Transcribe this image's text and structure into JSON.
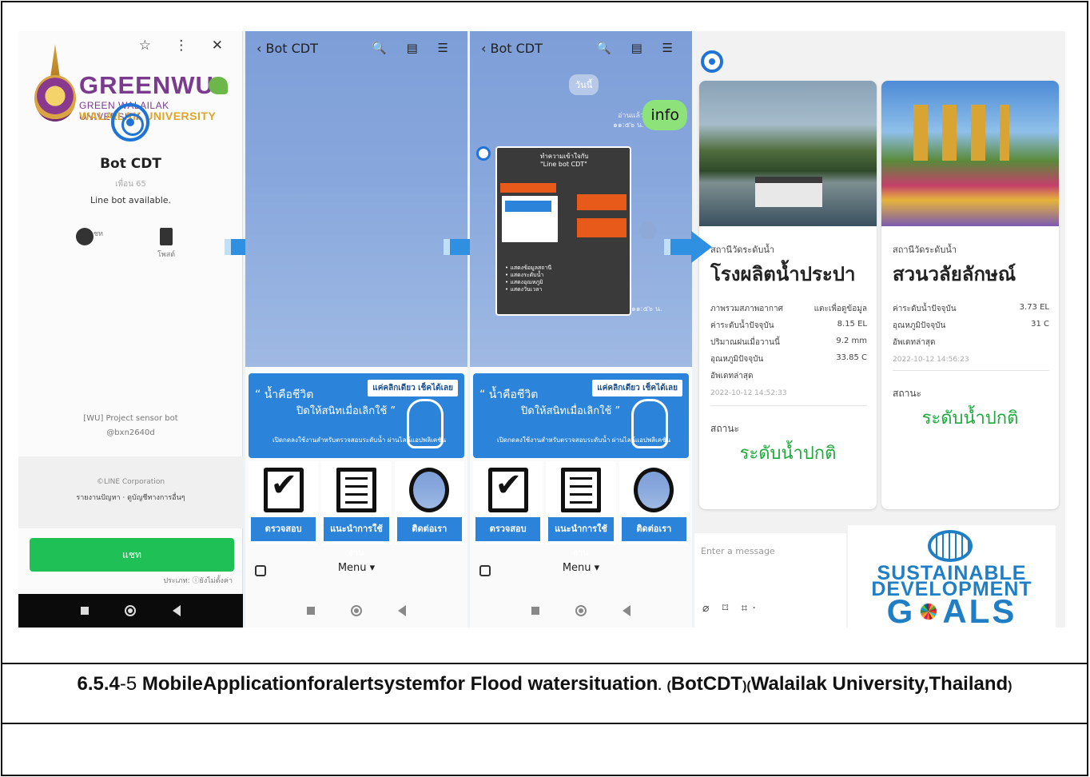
{
  "panel1": {
    "top_icons": "☆ ⋮ ✕",
    "logo_title": "GREENWU",
    "logo_sub1": "GREEN WALAILAK UNIVERSITY",
    "logo_sub2": "WALAILAK UNIVERSITY",
    "bot_name": "Bot CDT",
    "friends": "เพื่อน 65",
    "status": "Line bot available.",
    "actions": [
      {
        "label": "แชท"
      },
      {
        "label": "โพสต์"
      }
    ],
    "project": "[WU] Project sensor bot",
    "line_id": "@bxn2640d",
    "corp": "©LINE Corporation",
    "report": "รายงานปัญหา · ดูบัญชีทางการอื่นๆ",
    "chat_button": "แชท",
    "note": "ประเภท: ⓘยังไม่ตั้งค่า"
  },
  "chat": {
    "title": "Bot CDT",
    "header_icons": "🔍 ▤ ☰",
    "banner_quote1": "“ น้ำคือชีวิต",
    "banner_quote2": "ปิดให้สนิทเมื่อเลิกใช้ ”",
    "banner_tag": "แค่คลิกเดียว เช็คได้เลย",
    "banner_small": "เปิดกดลงใช้งานสำหรับตรวจสอบระดับน้ำ ผ่านไลน์แอปพลิเคชัน",
    "tiles": [
      {
        "label": "ตรวจสอบ"
      },
      {
        "label": "แนะนำการใช้งาน"
      },
      {
        "label": "ติดต่อเรา"
      }
    ],
    "menu": "Menu ▾",
    "day": "วันนี้",
    "info_msg": "info",
    "read_mark": "อ่านแล้ว\n๑๑:๕๖ น.",
    "poster_title": "ทำความเข้าใจกับ\n\"Line bot CDT\"",
    "poster_list": "• แสดงข้อมูลสถานี\n• แสดงระดับน้ำ\n• แสดงอุณหภูมิ\n• แสดงวันเวลา",
    "timestamp": "๑๑:๕๖ น."
  },
  "cards": [
    {
      "category": "สถานีวัดระดับน้ำ",
      "name": "โรงผลิตน้ำประปา",
      "rows": [
        {
          "k": "ภาพรวมสภาพอากาศ",
          "v": "แตะเพื่อดูข้อมูล"
        },
        {
          "k": "ค่าระดับน้ำปัจจุบัน",
          "v": "8.15 EL"
        },
        {
          "k": "ปริมาณฝนเมื่อวานนี้",
          "v": "9.2 mm"
        },
        {
          "k": "อุณหภูมิปัจจุบัน",
          "v": "33.85 C"
        },
        {
          "k": "อัพเดทล่าสุด",
          "v": ""
        }
      ],
      "date": "2022-10-12 14:52:33",
      "status_label": "สถานะ",
      "status": "ระดับน้ำปกติ"
    },
    {
      "category": "สถานีวัดระดับน้ำ",
      "name": "สวนวลัยลักษณ์",
      "rows": [
        {
          "k": "ค่าระดับน้ำปัจจุบัน",
          "v": "3.73 EL"
        },
        {
          "k": "อุณหภูมิปัจจุบัน",
          "v": "31 C"
        },
        {
          "k": "อัพเดทล่าสุด",
          "v": ""
        }
      ],
      "date": "2022-10-12 14:56:23",
      "status_label": "สถานะ",
      "status": "ระดับน้ำปกติ"
    }
  ],
  "input": {
    "placeholder": "Enter a message",
    "icons": "⌀ ⌑ ⌗·"
  },
  "sdg": {
    "line1": "SUSTAINABLE",
    "line2": "DEVELOPMENT",
    "goals_g": "G",
    "goals_rest": "ALS"
  },
  "caption": {
    "num": "6.5.4",
    "dash": "-5",
    "title": "MobileApplicationforalertsystemfor Flood watersituation",
    "dot": ".",
    "p1": "(",
    "bot": "BotCDT",
    "p2": ")(",
    "uni": "Walailak University,Thailand",
    "p3": ")"
  },
  "colors": {
    "line_green": "#1fc157",
    "line_blue": "#2b84d9",
    "status_green": "#1eaa3c",
    "sdg_blue": "#1f7ec4"
  }
}
